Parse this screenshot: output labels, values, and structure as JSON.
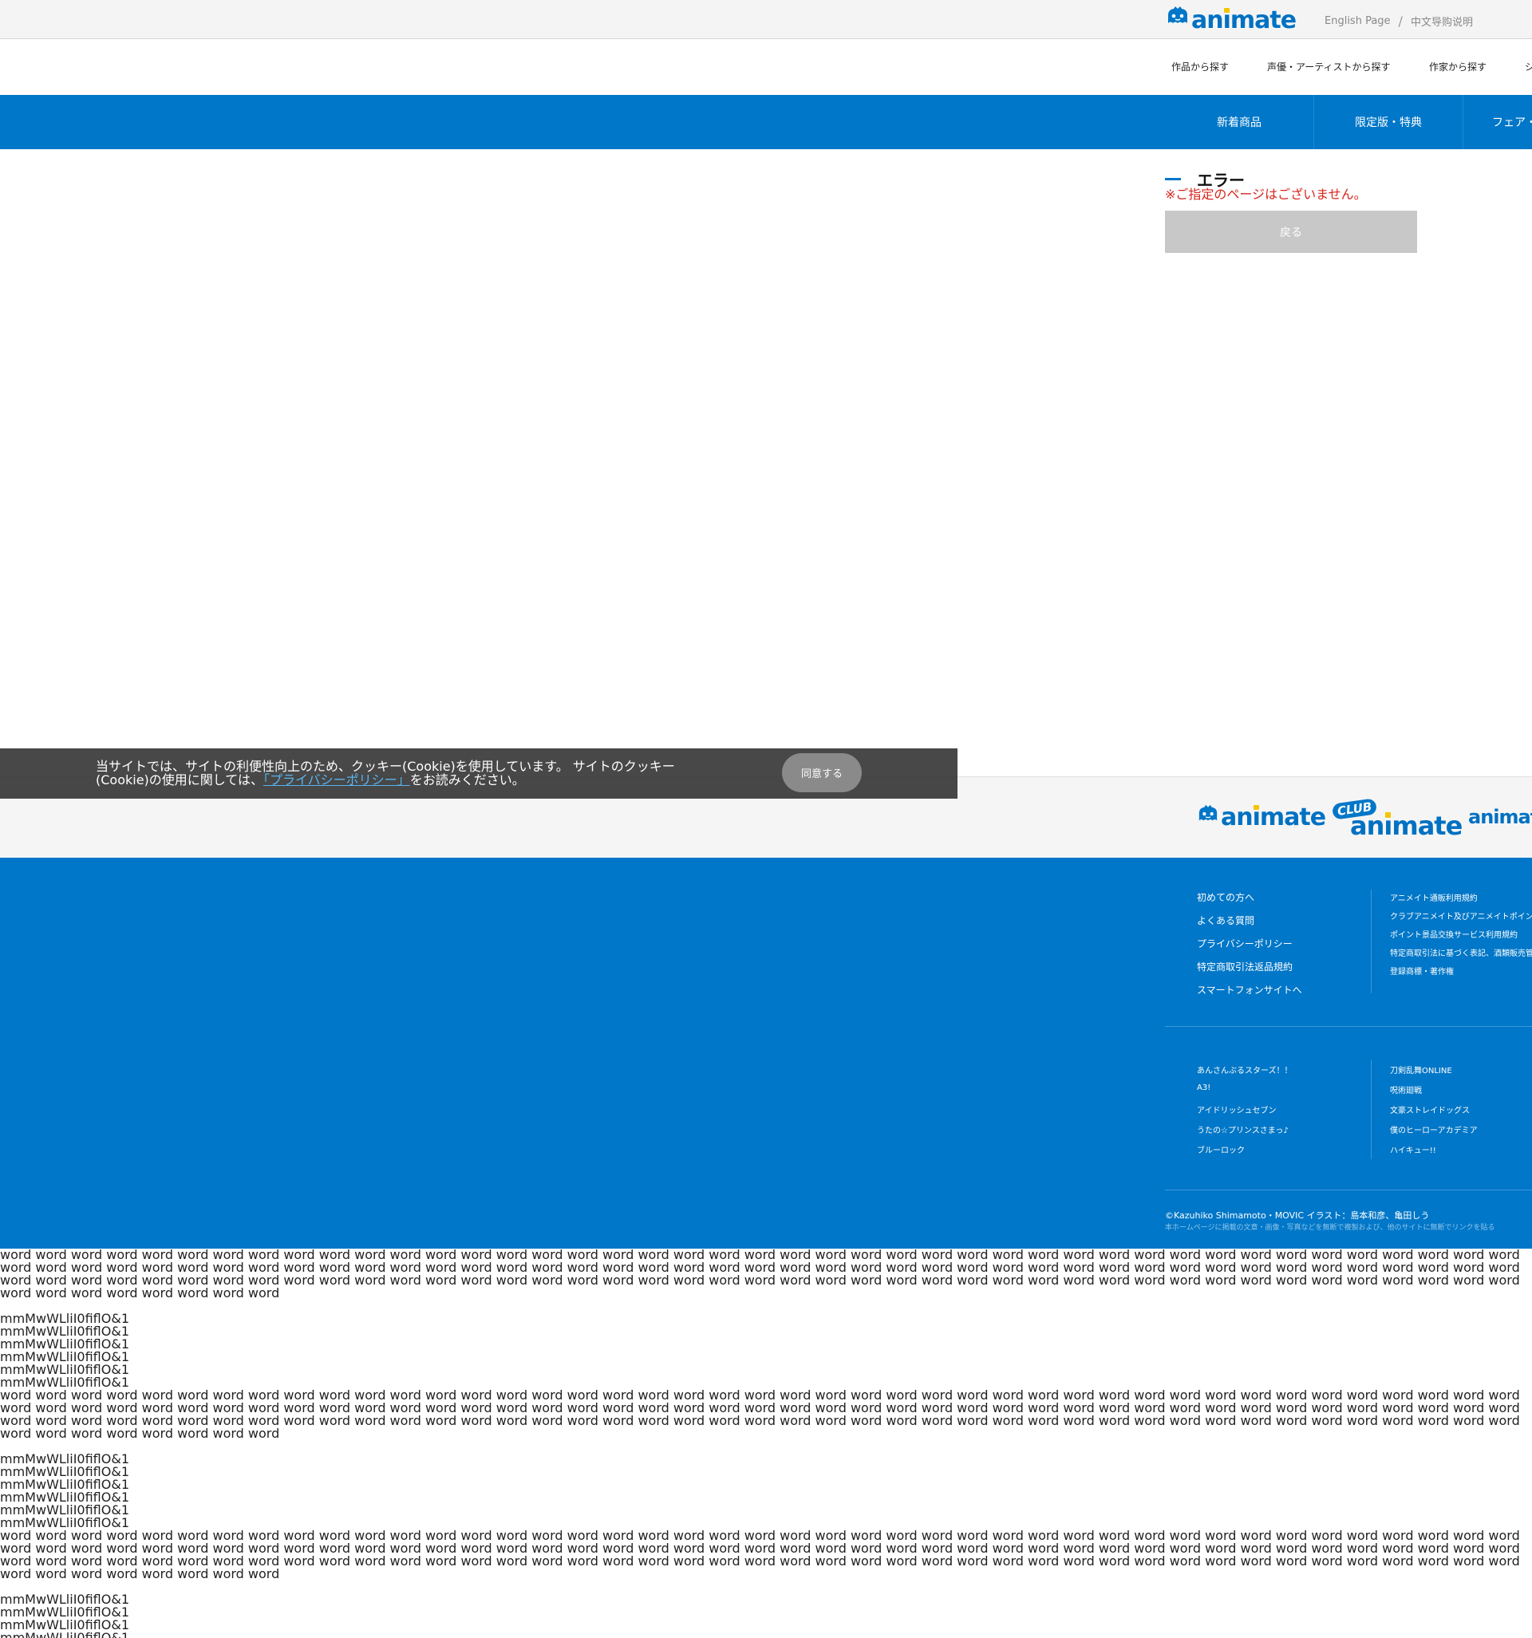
{
  "brand": {
    "name_prefix": "an",
    "name_i": "i",
    "name_suffix": "mate",
    "color": "#0077c8",
    "accent": "#f5c400"
  },
  "topbar": {
    "english_link": "English Page",
    "separator": "/",
    "chinese_link": "中文导购说明"
  },
  "subnav": {
    "items": [
      "作品から探す",
      "声優・アーティストから探す",
      "作家から探す",
      "シ"
    ]
  },
  "bluenav": {
    "items": [
      "新着商品",
      "限定版・特典",
      "フェア・"
    ]
  },
  "error": {
    "title": "エラー",
    "message": "※ご指定のページはございません。",
    "back_button": "戻る",
    "message_color": "#d8261c"
  },
  "cookie": {
    "text_before": "当サイトでは、サイトの利便性向上のため、クッキー(Cookie)を使用しています。 サイトのクッキー(Cookie)の使用に関しては、",
    "link_text": "「プライバシーポリシー」",
    "text_after": "をお読みください。",
    "agree_button": "同意する"
  },
  "footer_logos": {
    "club_badge": "CLUB",
    "third_logo": "animate"
  },
  "footer": {
    "left_links": [
      "初めての方へ",
      "よくある質問",
      "プライバシーポリシー",
      "特定商取引法返品規約",
      "スマートフォンサイトへ"
    ],
    "right_links": [
      "アニメイト通販利用規約",
      "クラブアニメイト及びアニメイトポイン",
      "ポイント景品交換サービス利用規約",
      "特定商取引法に基づく表記、酒類販売管",
      "登録商標・著作権"
    ],
    "title_left": [
      "あんさんぶるスターズ！！",
      "A3!",
      "アイドリッシュセブン",
      "うたの☆プリンスさまっ♪",
      "ブルーロック"
    ],
    "title_right": [
      "刀剣乱舞ONLINE",
      "呪術廻戦",
      "文豪ストレイドッグス",
      "僕のヒーローアカデミア",
      "ハイキュー!!"
    ],
    "copyright": "©Kazuhiko Shimamoto・MOVIC イラスト：島本和彦、亀田しう",
    "disclaimer": "本ホームページに掲載の文章・画像・写真などを無断で複製および、他のサイトに無断でリンクを貼る"
  },
  "filler": {
    "word_line": "word word word word word word word word word word word word word word word word word word word word word word word word word word word word word word word word word word word word word word word word word word word word word word word word word word word word word word word word word word word word word word word word word word word word word word word word word word word word word word word word word word word word word word word word word word word word word word word word word word word word word word word word word word word word word word word word word word word word word word word word word word word word word word word word word word word word word word word word word",
    "mm_line": "mmMwWLliI0fiflO&1"
  }
}
